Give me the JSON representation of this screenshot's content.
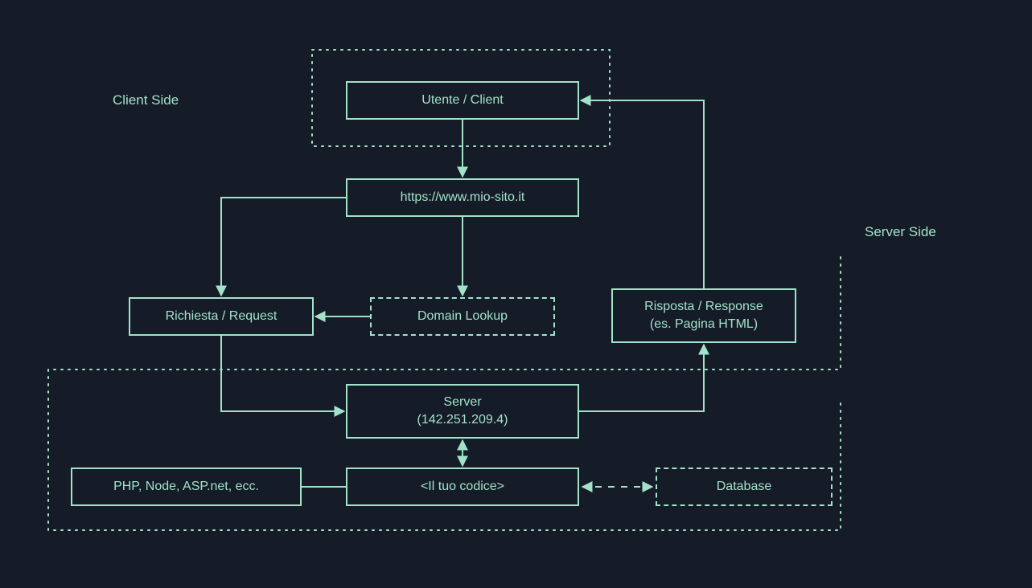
{
  "labels": {
    "client_side": "Client Side",
    "server_side": "Server Side"
  },
  "nodes": {
    "client": "Utente / Client",
    "url": "https://www.mio-sito.it",
    "request": "Richiesta / Request",
    "domain_lookup": "Domain Lookup",
    "response_line1": "Risposta / Response",
    "response_line2": "(es. Pagina HTML)",
    "server_line1": "Server",
    "server_line2": "(142.251.209.4)",
    "tech": "PHP, Node, ASP.net, ecc.",
    "code": "<Il tuo codice>",
    "database": "Database"
  },
  "colors": {
    "background": "#151c28",
    "line": "#a2e2c8"
  }
}
